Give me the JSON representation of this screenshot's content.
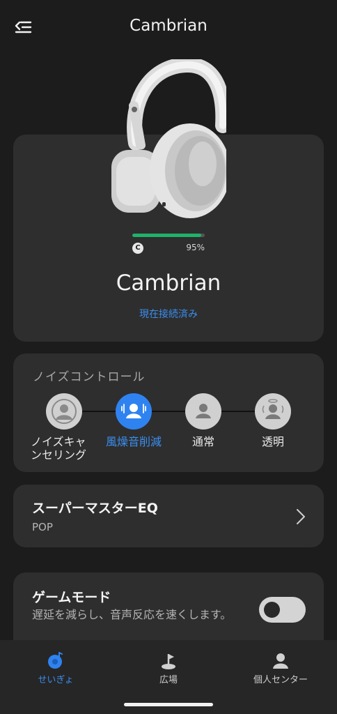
{
  "header": {
    "title": "Cambrian"
  },
  "device": {
    "name": "Cambrian",
    "status": "現在接続済み",
    "battery_percent_label": "95%",
    "battery_level": 0.95,
    "battery_icon_letter": "C"
  },
  "noise_control": {
    "title": "ノイズコントロール",
    "modes": [
      {
        "label_line1": "ノイズキャ",
        "label_line2": "ンセリング",
        "active": false
      },
      {
        "label_line1": "風燥音削減",
        "label_line2": "",
        "active": true
      },
      {
        "label_line1": "通常",
        "label_line2": "",
        "active": false
      },
      {
        "label_line1": "透明",
        "label_line2": "",
        "active": false
      }
    ]
  },
  "eq": {
    "title": "スーパーマスターEQ",
    "value": "POP"
  },
  "game_mode": {
    "title": "ゲームモード",
    "description": "遅延を減らし、音声反応を速くします。",
    "enabled": false
  },
  "tabs": [
    {
      "label": "せいぎょ",
      "icon": "control-icon",
      "active": true
    },
    {
      "label": "広場",
      "icon": "plaza-icon",
      "active": false
    },
    {
      "label": "個人センター",
      "icon": "profile-icon",
      "active": false
    }
  ],
  "colors": {
    "accent": "#2f83f0",
    "battery": "#1fb26b",
    "card": "#2e2e2e",
    "background": "#1c1c1c"
  }
}
